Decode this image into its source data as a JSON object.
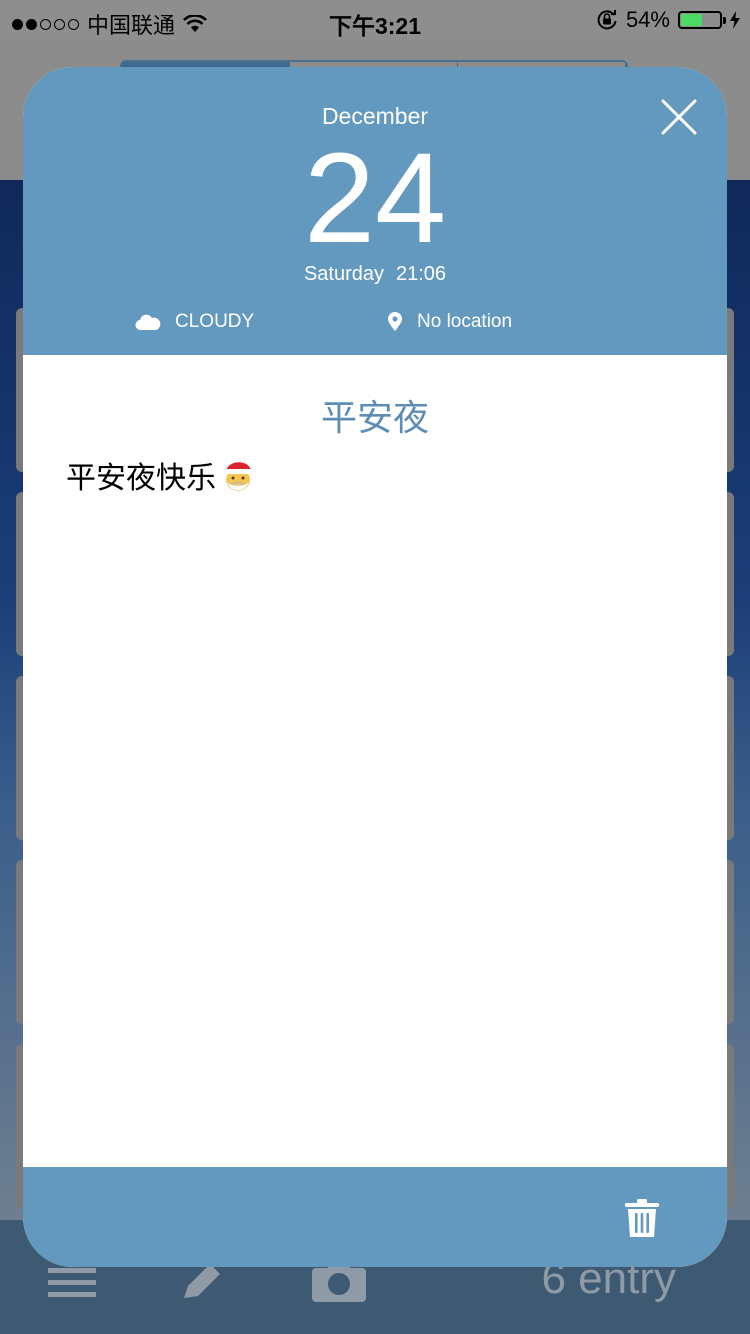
{
  "status_bar": {
    "carrier": "中国联通",
    "time": "下午3:21",
    "battery_percent": "54%",
    "battery_level": 0.54,
    "signal_bars": 2,
    "icons": [
      "wifi-icon",
      "rotation-lock-icon",
      "battery-icon",
      "charging-icon"
    ]
  },
  "entry": {
    "month": "December",
    "day": "24",
    "weekday": "Saturday",
    "time": "21:06",
    "weather": "CLOUDY",
    "location": "No location",
    "title": "平安夜",
    "body": "平安夜快乐"
  },
  "toolbar": {
    "count_label": "6 entry"
  },
  "colors": {
    "header_blue": "#6399be",
    "title_blue": "#5d8db3",
    "battery_green": "#4cd964"
  }
}
